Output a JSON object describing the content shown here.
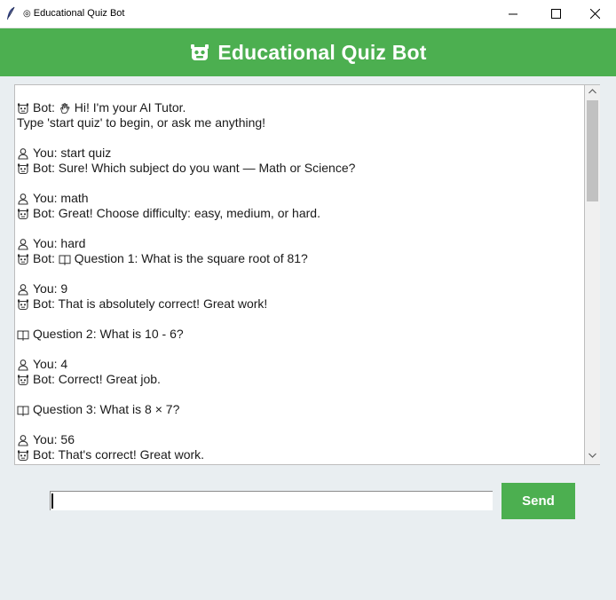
{
  "window": {
    "title": "Educational Quiz Bot"
  },
  "header": {
    "title": "Educational Quiz Bot",
    "icon": "robot-icon",
    "color": "#4caf50"
  },
  "chat": {
    "lines": [
      {
        "icon": "robot",
        "text": "Bot: ",
        "icon2": "wave",
        "text2": "Hi! I'm your AI Tutor."
      },
      {
        "text": "Type 'start quiz' to begin, or ask me anything!"
      },
      {
        "blank": true
      },
      {
        "icon": "user",
        "text": "You: start quiz"
      },
      {
        "icon": "robot",
        "text": "Bot: Sure! Which subject do you want — Math or Science?"
      },
      {
        "blank": true
      },
      {
        "icon": "user",
        "text": "You: math"
      },
      {
        "icon": "robot",
        "text": "Bot: Great! Choose difficulty: easy, medium, or hard."
      },
      {
        "blank": true
      },
      {
        "icon": "user",
        "text": "You: hard"
      },
      {
        "icon": "robot",
        "text": "Bot: ",
        "icon2": "book",
        "text2": "Question 1: What is the square root of 81?"
      },
      {
        "blank": true
      },
      {
        "icon": "user",
        "text": "You: 9"
      },
      {
        "icon": "robot",
        "text": "Bot: That is absolutely correct! Great work!"
      },
      {
        "blank": true
      },
      {
        "icon": "book",
        "text": "Question 2: What is 10 - 6?"
      },
      {
        "blank": true
      },
      {
        "icon": "user",
        "text": "You: 4"
      },
      {
        "icon": "robot",
        "text": "Bot: Correct! Great job."
      },
      {
        "blank": true
      },
      {
        "icon": "book",
        "text": "Question 3: What is 8 × 7?"
      },
      {
        "blank": true
      },
      {
        "icon": "user",
        "text": "You: 56"
      },
      {
        "icon": "robot",
        "text": "Bot: That's correct! Great work."
      }
    ]
  },
  "input": {
    "value": ""
  },
  "send_button": {
    "label": "Send",
    "color": "#4caf50"
  }
}
